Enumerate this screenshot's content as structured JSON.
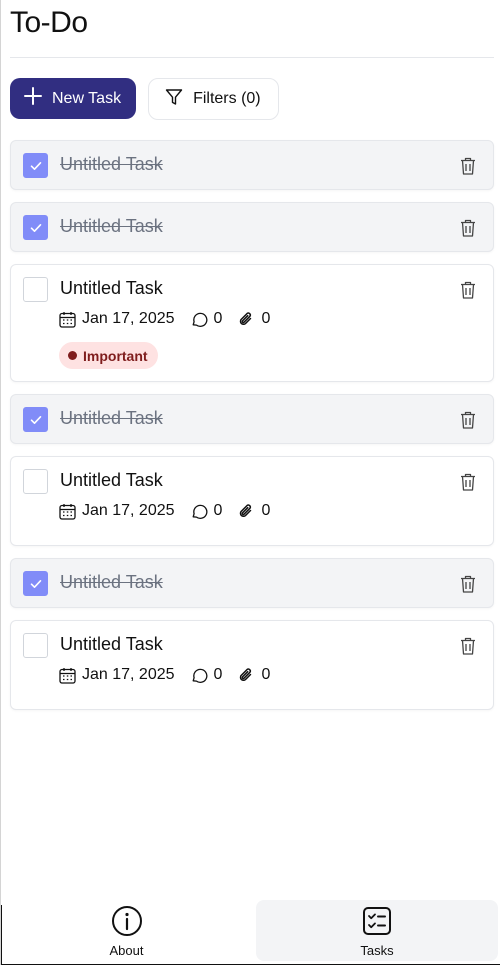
{
  "app": {
    "title": "To-Do"
  },
  "toolbar": {
    "new_task_label": "New Task",
    "filters_label": "Filters (0)"
  },
  "tasks": [
    {
      "title": "Untitled Task",
      "completed": true
    },
    {
      "title": "Untitled Task",
      "completed": true
    },
    {
      "title": "Untitled Task",
      "completed": false,
      "date": "Jan 17, 2025",
      "comments": "0",
      "attachments": "0",
      "badge": "Important"
    },
    {
      "title": "Untitled Task",
      "completed": true
    },
    {
      "title": "Untitled Task",
      "completed": false,
      "date": "Jan 17, 2025",
      "comments": "0",
      "attachments": "0"
    },
    {
      "title": "Untitled Task",
      "completed": true
    },
    {
      "title": "Untitled Task",
      "completed": false,
      "date": "Jan 17, 2025",
      "comments": "0",
      "attachments": "0"
    }
  ],
  "nav": {
    "about_label": "About",
    "tasks_label": "Tasks",
    "active": "tasks"
  },
  "colors": {
    "primary": "#312e81",
    "checkbox_checked": "#818cf8",
    "badge_bg": "#fee2e2",
    "badge_text": "#7f1d1d",
    "done_bg": "#f3f4f6"
  },
  "icons": {
    "new_task": "plus-icon",
    "filters": "filter-icon",
    "delete": "trash-icon",
    "date": "calendar-icon",
    "comments": "comment-icon",
    "attachments": "paperclip-icon",
    "about": "info-icon",
    "tasks": "checklist-icon"
  }
}
